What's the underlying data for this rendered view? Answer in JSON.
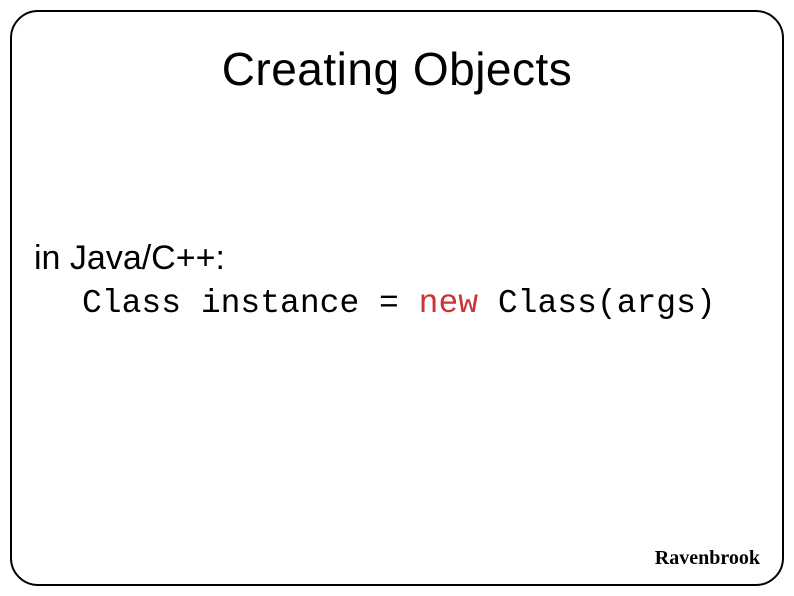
{
  "slide": {
    "title": "Creating Objects",
    "intro": "in Java/C++:",
    "code": {
      "part1": "Class instance = ",
      "keyword": "new",
      "part2": " Class(args)"
    }
  },
  "footer": {
    "brand": "Ravenbrook"
  }
}
